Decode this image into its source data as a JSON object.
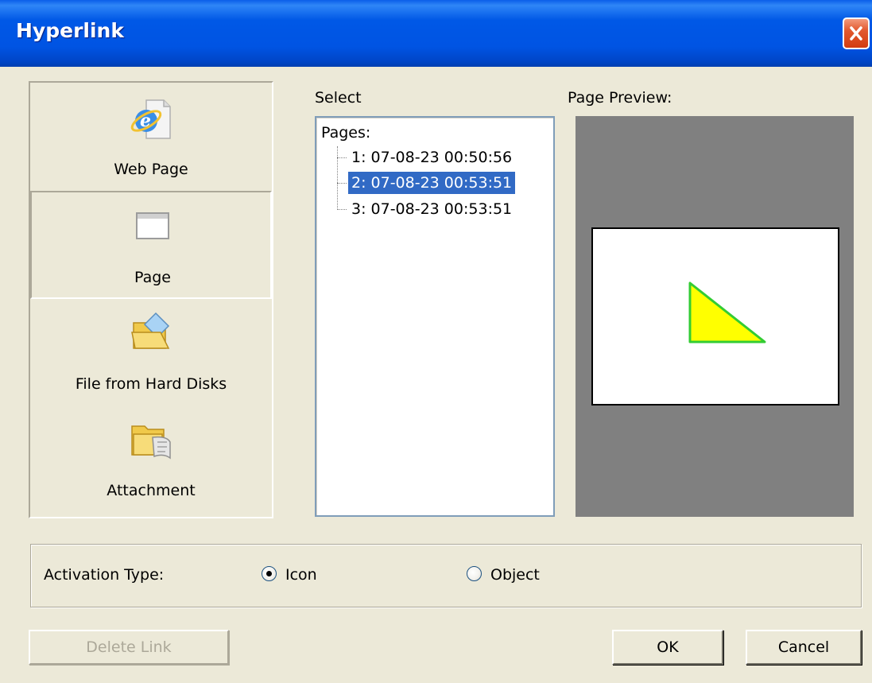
{
  "window": {
    "title": "Hyperlink"
  },
  "categories": [
    {
      "label": "Web Page",
      "icon": "internet-explorer-icon",
      "selected": false
    },
    {
      "label": "Page",
      "icon": "page-window-icon",
      "selected": true
    },
    {
      "label": "File from Hard Disks",
      "icon": "folder-file-icon",
      "selected": false
    },
    {
      "label": "Attachment",
      "icon": "attachment-folder-icon",
      "selected": false
    }
  ],
  "select": {
    "label": "Select",
    "root": "Pages:",
    "items": [
      {
        "label": "1:  07-08-23 00:50:56",
        "selected": false
      },
      {
        "label": "2:  07-08-23 00:53:51",
        "selected": true
      },
      {
        "label": "3:  07-08-23 00:53:51",
        "selected": false
      }
    ]
  },
  "preview": {
    "label": "Page Preview:",
    "shape": "triangle",
    "shape_fill": "#ffff00",
    "shape_stroke": "#33cc33",
    "background": "#808080"
  },
  "activation": {
    "label": "Activation Type:",
    "options": [
      {
        "label": "Icon",
        "checked": true
      },
      {
        "label": "Object",
        "checked": false
      }
    ]
  },
  "buttons": {
    "delete_link": "Delete Link",
    "ok": "OK",
    "cancel": "Cancel"
  },
  "colors": {
    "titlebar": "#0054e3",
    "selection": "#316ac5",
    "dialog_bg": "#ece9d8"
  }
}
